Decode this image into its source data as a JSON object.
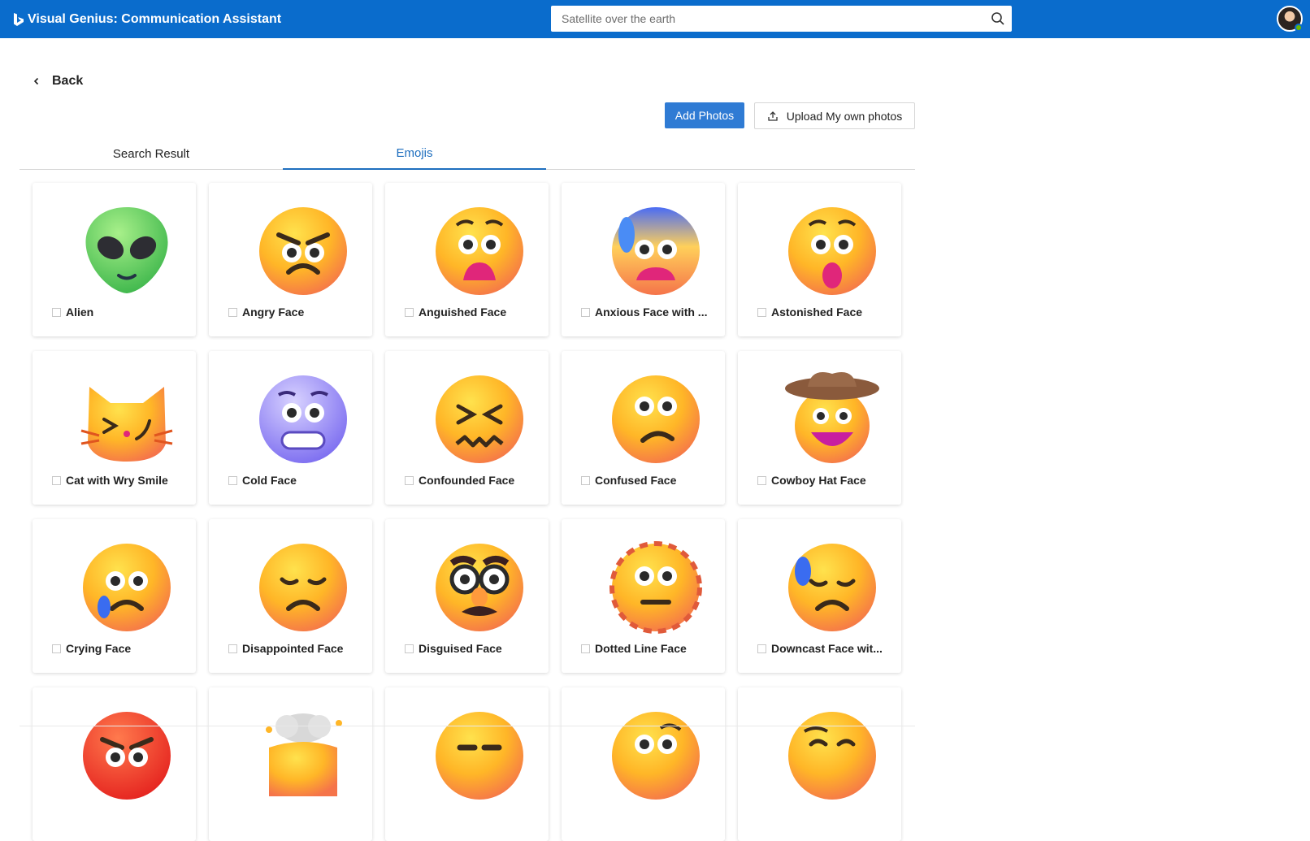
{
  "app": {
    "title": "Visual Genius: Communication Assistant"
  },
  "search": {
    "placeholder": "Satellite over the earth",
    "value": "Satellite over the earth"
  },
  "nav": {
    "back_label": "Back"
  },
  "actions": {
    "add_photos": "Add Photos",
    "upload": "Upload My own photos"
  },
  "tabs": [
    {
      "label": "Search Result",
      "active": false
    },
    {
      "label": "Emojis",
      "active": true
    }
  ],
  "colors": {
    "header": "#0a6ccc",
    "primary_button": "#2f7bd4",
    "active_tab": "#1f6fbf"
  },
  "emojis": [
    {
      "label": "Alien",
      "icon": "alien-icon"
    },
    {
      "label": "Angry Face",
      "icon": "angry-face-icon"
    },
    {
      "label": "Anguished Face",
      "icon": "anguished-face-icon"
    },
    {
      "label": "Anxious Face with ...",
      "icon": "anxious-face-icon"
    },
    {
      "label": "Astonished Face",
      "icon": "astonished-face-icon"
    },
    {
      "label": "Cat with Wry Smile",
      "icon": "cat-wry-smile-icon"
    },
    {
      "label": "Cold Face",
      "icon": "cold-face-icon"
    },
    {
      "label": "Confounded Face",
      "icon": "confounded-face-icon"
    },
    {
      "label": "Confused Face",
      "icon": "confused-face-icon"
    },
    {
      "label": "Cowboy Hat Face",
      "icon": "cowboy-hat-face-icon"
    },
    {
      "label": "Crying Face",
      "icon": "crying-face-icon"
    },
    {
      "label": "Disappointed Face",
      "icon": "disappointed-face-icon"
    },
    {
      "label": "Disguised Face",
      "icon": "disguised-face-icon"
    },
    {
      "label": "Dotted Line Face",
      "icon": "dotted-line-face-icon"
    },
    {
      "label": "Downcast Face wit...",
      "icon": "downcast-face-icon"
    },
    {
      "label": "",
      "icon": "enraged-face-icon"
    },
    {
      "label": "",
      "icon": "exploding-head-icon"
    },
    {
      "label": "",
      "icon": "expressionless-face-icon"
    },
    {
      "label": "",
      "icon": "face-with-raised-eyebrow-icon"
    },
    {
      "label": "",
      "icon": "relieved-face-icon"
    }
  ]
}
